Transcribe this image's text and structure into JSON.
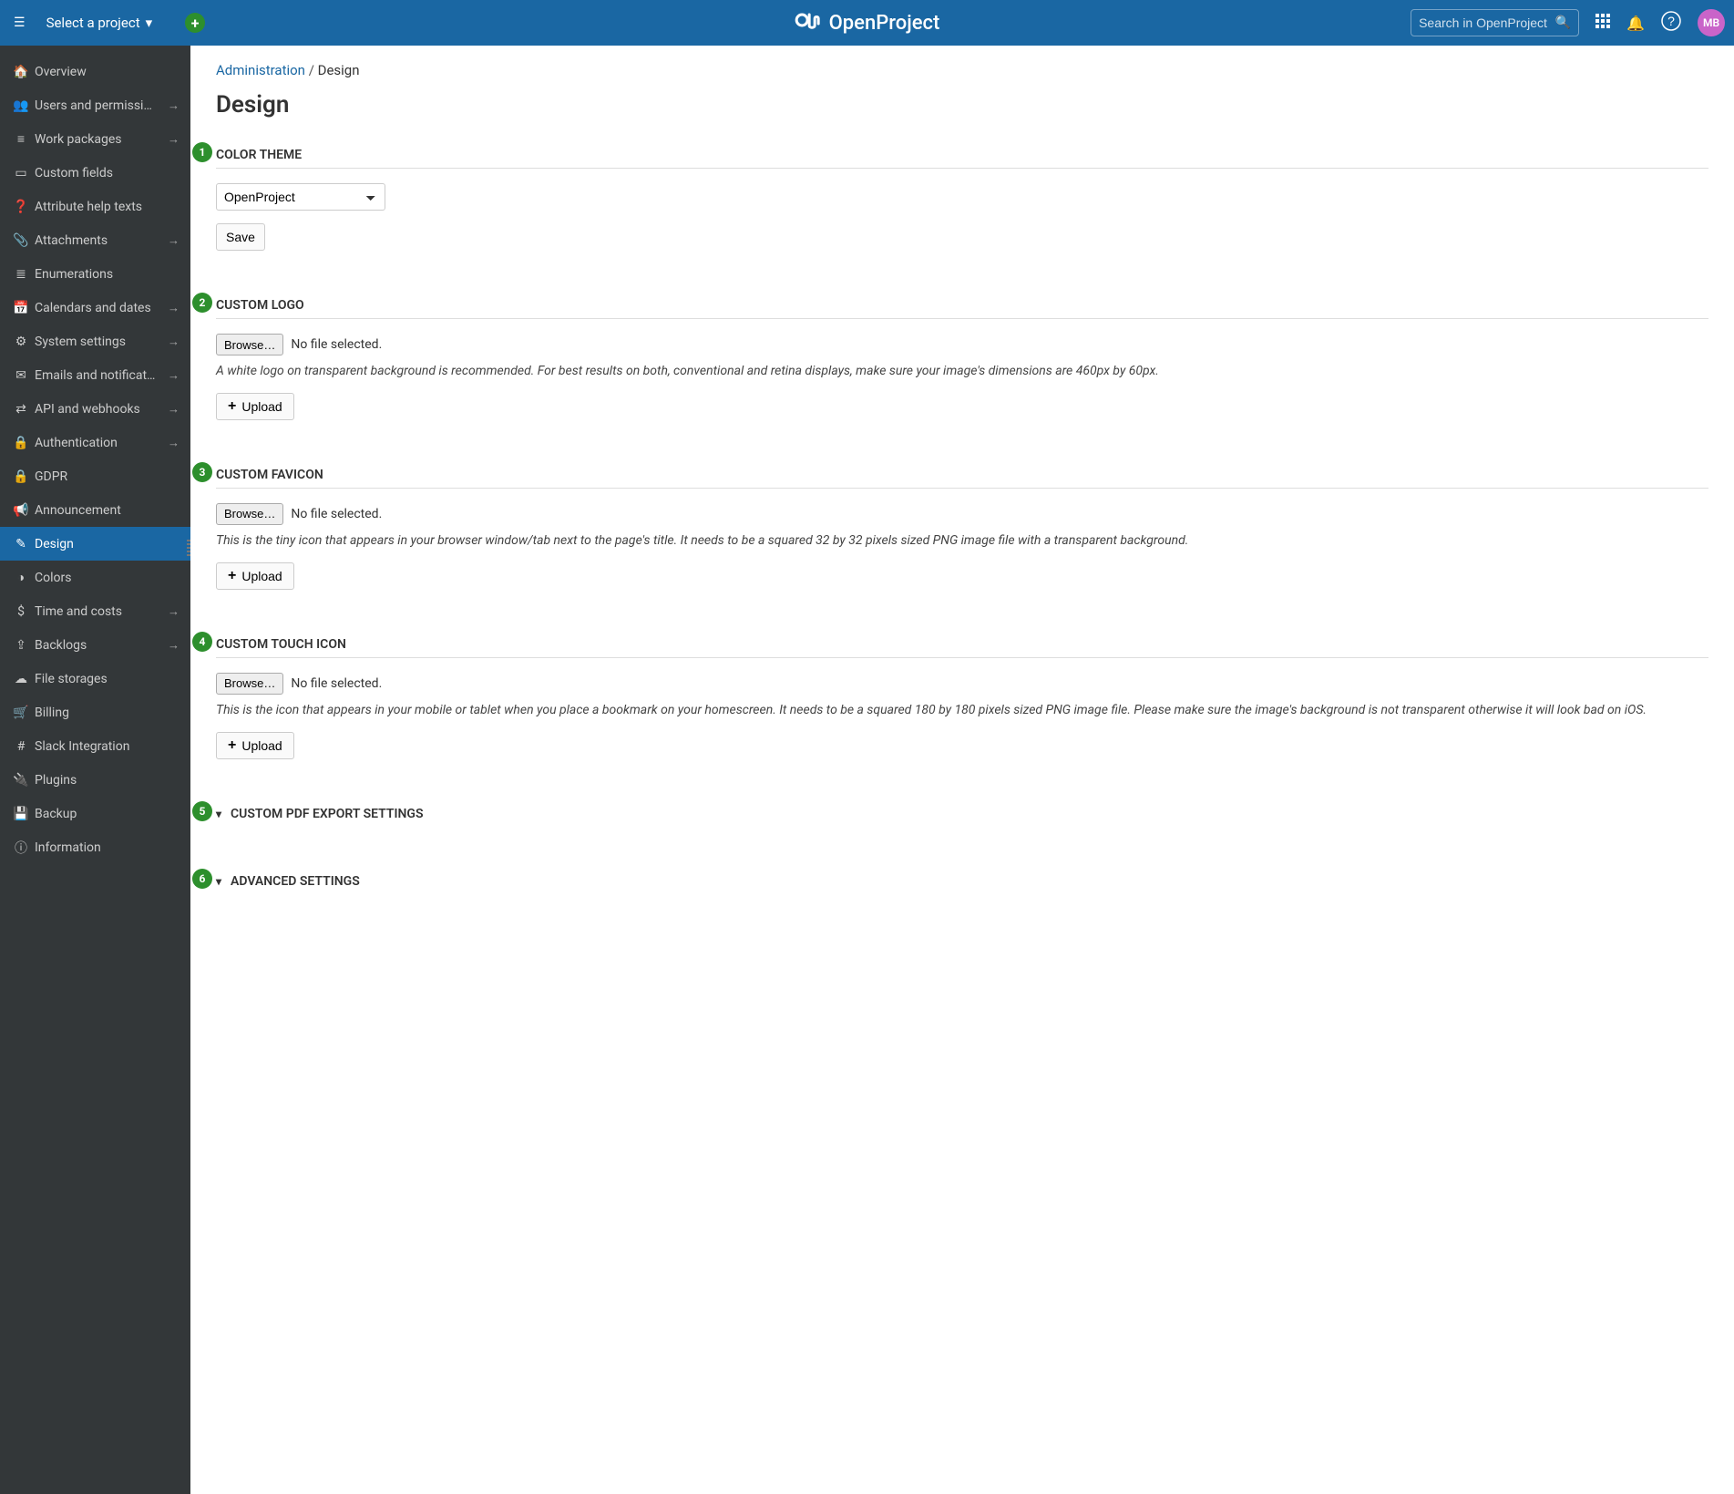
{
  "header": {
    "project_selector_label": "Select a project",
    "search_placeholder": "Search in OpenProject",
    "brand_name": "OpenProject",
    "avatar_initials": "MB"
  },
  "sidebar": {
    "items": [
      {
        "icon": "🏠",
        "label": "Overview",
        "arrow": false
      },
      {
        "icon": "👥",
        "label": "Users and permissi…",
        "arrow": true
      },
      {
        "icon": "≡",
        "label": "Work packages",
        "arrow": true
      },
      {
        "icon": "▭",
        "label": "Custom fields",
        "arrow": false
      },
      {
        "icon": "❓",
        "label": "Attribute help texts",
        "arrow": false
      },
      {
        "icon": "📎",
        "label": "Attachments",
        "arrow": true
      },
      {
        "icon": "≣",
        "label": "Enumerations",
        "arrow": false
      },
      {
        "icon": "📅",
        "label": "Calendars and dates",
        "arrow": true
      },
      {
        "icon": "⚙",
        "label": "System settings",
        "arrow": true
      },
      {
        "icon": "✉",
        "label": "Emails and notificat…",
        "arrow": true
      },
      {
        "icon": "⇄",
        "label": "API and webhooks",
        "arrow": true
      },
      {
        "icon": "🔒",
        "label": "Authentication",
        "arrow": true
      },
      {
        "icon": "🔒",
        "label": "GDPR",
        "arrow": false
      },
      {
        "icon": "📢",
        "label": "Announcement",
        "arrow": false
      },
      {
        "icon": "✎",
        "label": "Design",
        "arrow": false,
        "active": true
      },
      {
        "icon": "◑",
        "label": "Colors",
        "arrow": false
      },
      {
        "icon": "$",
        "label": "Time and costs",
        "arrow": true
      },
      {
        "icon": "⇪",
        "label": "Backlogs",
        "arrow": true
      },
      {
        "icon": "☁",
        "label": "File storages",
        "arrow": false
      },
      {
        "icon": "🛒",
        "label": "Billing",
        "arrow": false
      },
      {
        "icon": "#",
        "label": "Slack Integration",
        "arrow": false
      },
      {
        "icon": "🔌",
        "label": "Plugins",
        "arrow": false
      },
      {
        "icon": "💾",
        "label": "Backup",
        "arrow": false
      },
      {
        "icon": "ⓘ",
        "label": "Information",
        "arrow": false
      }
    ]
  },
  "breadcrumb": {
    "root": "Administration",
    "current": "Design"
  },
  "page_title": "Design",
  "steps": [
    "1",
    "2",
    "3",
    "4",
    "5",
    "6"
  ],
  "sections": {
    "color_theme": {
      "title": "COLOR THEME",
      "selected_option": "OpenProject",
      "save_label": "Save"
    },
    "custom_logo": {
      "title": "CUSTOM LOGO",
      "browse_label": "Browse…",
      "file_status": "No file selected.",
      "hint": "A white logo on transparent background is recommended. For best results on both, conventional and retina displays, make sure your image's dimensions are 460px by 60px.",
      "upload_label": "Upload"
    },
    "custom_favicon": {
      "title": "CUSTOM FAVICON",
      "browse_label": "Browse…",
      "file_status": "No file selected.",
      "hint": "This is the tiny icon that appears in your browser window/tab next to the page's title. It needs to be a squared 32 by 32 pixels sized PNG image file with a transparent background.",
      "upload_label": "Upload"
    },
    "custom_touch": {
      "title": "CUSTOM TOUCH ICON",
      "browse_label": "Browse…",
      "file_status": "No file selected.",
      "hint": "This is the icon that appears in your mobile or tablet when you place a bookmark on your homescreen. It needs to be a squared 180 by 180 pixels sized PNG image file. Please make sure the image's background is not transparent otherwise it will look bad on iOS.",
      "upload_label": "Upload"
    },
    "pdf_export": {
      "title": "CUSTOM PDF EXPORT SETTINGS"
    },
    "advanced": {
      "title": "ADVANCED SETTINGS"
    }
  }
}
